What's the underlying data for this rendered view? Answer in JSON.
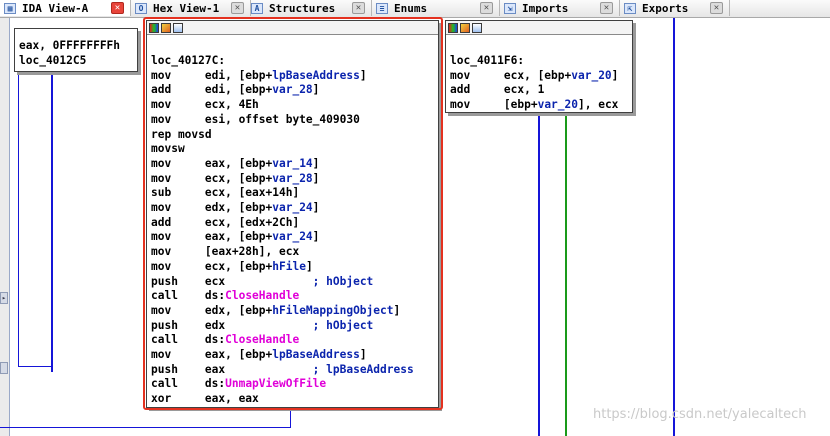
{
  "tabs": [
    {
      "label": "IDA View-A",
      "icon": "ida-view-icon",
      "active": true
    },
    {
      "label": "Hex View-1",
      "icon": "hex-view-icon",
      "active": false
    },
    {
      "label": "Structures",
      "icon": "structures-icon",
      "active": false
    },
    {
      "label": "Enums",
      "icon": "enums-icon",
      "active": false
    },
    {
      "label": "Imports",
      "icon": "imports-icon",
      "active": false
    },
    {
      "label": "Exports",
      "icon": "exports-icon",
      "active": false
    }
  ],
  "close_glyph": "✕",
  "left_node": {
    "lines": [
      "eax, 0FFFFFFFFh",
      "loc_4012C5"
    ]
  },
  "right_node": {
    "lines": [
      {
        "a": "loc_4011F6:",
        "b": "",
        "c": ""
      },
      {
        "a": "mov",
        "b": "ecx, [ebp+",
        "v": "var_20",
        "e": "]"
      },
      {
        "a": "add",
        "b": "ecx, 1"
      },
      {
        "a": "mov",
        "b": "[ebp+",
        "v": "var_20",
        "e": "], ecx"
      }
    ]
  },
  "main_node": {
    "label": "loc_40127C:",
    "lines": [
      {
        "op": "mov",
        "pre": "edi, [ebp+",
        "sym": "lpBaseAddress",
        "post": "]"
      },
      {
        "op": "add",
        "pre": "edi, [ebp+",
        "sym": "var_28",
        "post": "]"
      },
      {
        "op": "mov",
        "pre": "ecx, 4Eh"
      },
      {
        "op": "mov",
        "pre": "esi, offset byte_409030"
      },
      {
        "op": "rep movsd",
        "pre": ""
      },
      {
        "op": "movsw",
        "pre": ""
      },
      {
        "op": "mov",
        "pre": "eax, [ebp+",
        "sym": "var_14",
        "post": "]"
      },
      {
        "op": "mov",
        "pre": "ecx, [ebp+",
        "sym": "var_28",
        "post": "]"
      },
      {
        "op": "sub",
        "pre": "ecx, [eax+14h]"
      },
      {
        "op": "mov",
        "pre": "edx, [ebp+",
        "sym": "var_24",
        "post": "]"
      },
      {
        "op": "add",
        "pre": "ecx, [edx+2Ch]"
      },
      {
        "op": "mov",
        "pre": "eax, [ebp+",
        "sym": "var_24",
        "post": "]"
      },
      {
        "op": "mov",
        "pre": "[eax+28h], ecx"
      },
      {
        "op": "mov",
        "pre": "ecx, [ebp+",
        "sym": "hFile",
        "post": "]"
      },
      {
        "op": "push",
        "pre": "ecx",
        "cmt": "; hObject"
      },
      {
        "op": "call",
        "pre": "ds:",
        "fn": "CloseHandle"
      },
      {
        "op": "mov",
        "pre": "edx, [ebp+",
        "sym": "hFileMappingObject",
        "post": "]"
      },
      {
        "op": "push",
        "pre": "edx",
        "cmt": "; hObject"
      },
      {
        "op": "call",
        "pre": "ds:",
        "fn": "CloseHandle"
      },
      {
        "op": "mov",
        "pre": "eax, [ebp+",
        "sym": "lpBaseAddress",
        "post": "]"
      },
      {
        "op": "push",
        "pre": "eax",
        "cmt": "; lpBaseAddress"
      },
      {
        "op": "call",
        "pre": "ds:",
        "fn": "UnmapViewOfFile"
      },
      {
        "op": "xor",
        "pre": "eax, eax"
      }
    ]
  },
  "watermark": "https://blog.csdn.net/yalecaltech",
  "colors": {
    "edge_blue": "#1515d8",
    "edge_green": "#1a9a1a",
    "highlight": "#e4311f",
    "symbol": "#0b24ad",
    "api": "#e000d8"
  }
}
